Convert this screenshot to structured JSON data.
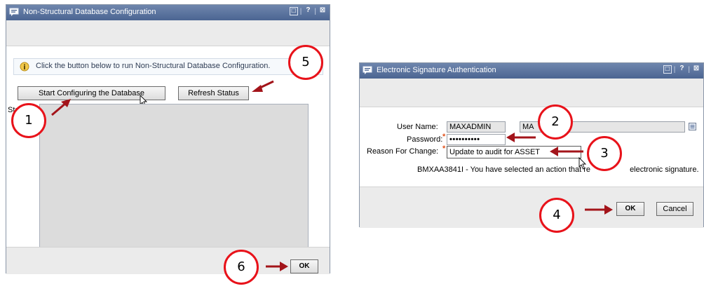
{
  "left_dialog": {
    "title": "Non-Structural Database Configuration",
    "window_controls": [
      "□",
      "?",
      "⊠"
    ],
    "info_text": "Click the button below to run Non-Structural Database Configuration.",
    "start_button": "Start Configuring the Database",
    "refresh_button": "Refresh Status",
    "status_label": "Status",
    "ok_button": "OK"
  },
  "right_dialog": {
    "title": "Electronic Signature Authentication",
    "window_controls": [
      "□",
      "?",
      "⊠"
    ],
    "username_label": "User Name:",
    "username_value": "MAXADMIN",
    "username_display": "MA",
    "password_label": "Password:",
    "password_value": "••••••••••",
    "reason_label": "Reason For Change:",
    "reason_value": "Update to audit for ASSET",
    "message_prefix": "BMXAA3841I - You have selected an action that re",
    "message_suffix": "electronic signature.",
    "ok_button": "OK",
    "cancel_button": "Cancel"
  },
  "callouts": [
    "1",
    "2",
    "3",
    "4",
    "5",
    "6"
  ],
  "colors": {
    "callout": "#e8121a",
    "arrow": "#a3141a",
    "titlebar": "#4b6592"
  }
}
